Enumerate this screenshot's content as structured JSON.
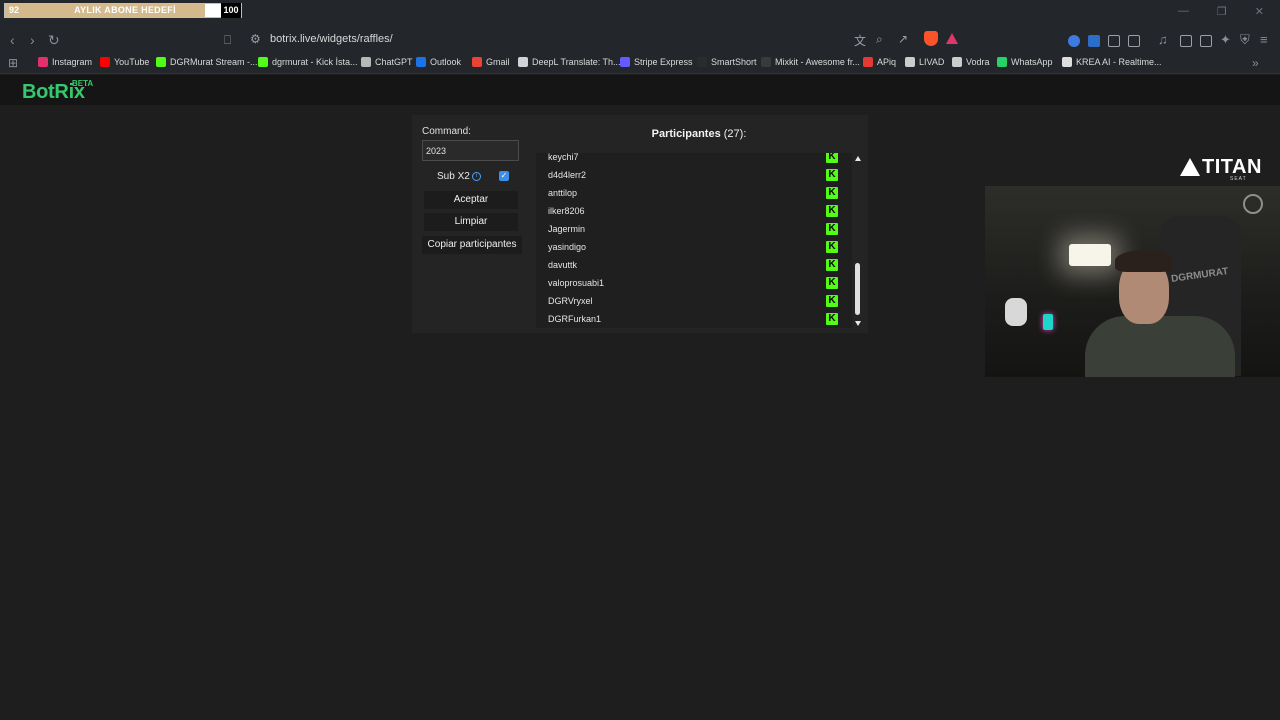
{
  "browser": {
    "goal_bar": {
      "start": "92",
      "title": "AYLIK ABONE HEDEFİ",
      "end": "100",
      "progress_fraction": 0.92,
      "fill_color": "#d3b98c"
    },
    "url": "botrix.live/widgets/raffles/",
    "bookmarks": [
      {
        "label": "Instagram",
        "icon": "instagram-icon",
        "color": "#e1306c"
      },
      {
        "label": "YouTube",
        "icon": "youtube-icon",
        "color": "#ff0000"
      },
      {
        "label": "DGRMurat Stream -...",
        "icon": "kick-icon",
        "color": "#53fc18"
      },
      {
        "label": "dgrmurat - Kick İsta...",
        "icon": "kick-icon",
        "color": "#53fc18"
      },
      {
        "label": "ChatGPT",
        "icon": "chatgpt-icon",
        "color": "#b8b8b8"
      },
      {
        "label": "Outlook",
        "icon": "outlook-icon",
        "color": "#1a73e8"
      },
      {
        "label": "Gmail",
        "icon": "gmail-icon",
        "color": "#ea4335"
      },
      {
        "label": "DeepL Translate: Th...",
        "icon": "deepl-icon",
        "color": "#cfd3d8"
      },
      {
        "label": "Stripe Express",
        "icon": "stripe-icon",
        "color": "#635bff"
      },
      {
        "label": "SmartShort",
        "icon": "smartshort-icon",
        "color": "#2b2b2b"
      },
      {
        "label": "Mixkit - Awesome fr...",
        "icon": "mixkit-icon",
        "color": "#3a3a3a"
      },
      {
        "label": "APiq",
        "icon": "apiq-icon",
        "color": "#e53935"
      },
      {
        "label": "LIVAD",
        "icon": "livad-icon",
        "color": "#cccccc"
      },
      {
        "label": "Vodra",
        "icon": "vodra-icon",
        "color": "#cccccc"
      },
      {
        "label": "WhatsApp",
        "icon": "whatsapp-icon",
        "color": "#25d366"
      },
      {
        "label": "KREA AI - Realtime...",
        "icon": "krea-icon",
        "color": "#dddddd"
      }
    ]
  },
  "app": {
    "logo": "BotRix",
    "logo_badge": "BETA",
    "brand_color": "#35c96e"
  },
  "raffle": {
    "command_label": "Command:",
    "command_value": "2023",
    "sub_label": "Sub X2",
    "sub_checked": true,
    "buttons": {
      "accept": "Aceptar",
      "clear": "Limpiar",
      "copy": "Copiar participantes"
    },
    "participants_title": "Participantes",
    "participants_count": "(27):",
    "participants": [
      "keychi7",
      "d4d4lerr2",
      "anttilop",
      "ilker8206",
      "Jagermin",
      "yasindigo",
      "davuttk",
      "valoprosuabi1",
      "DGRVryxel",
      "DGRFurkan1"
    ],
    "platform_badge": "K",
    "platform_color": "#53fc18"
  },
  "overlay": {
    "sponsor": "TITAN",
    "sponsor_sub": "SEAT",
    "chair_text": "DGRMURAT"
  }
}
